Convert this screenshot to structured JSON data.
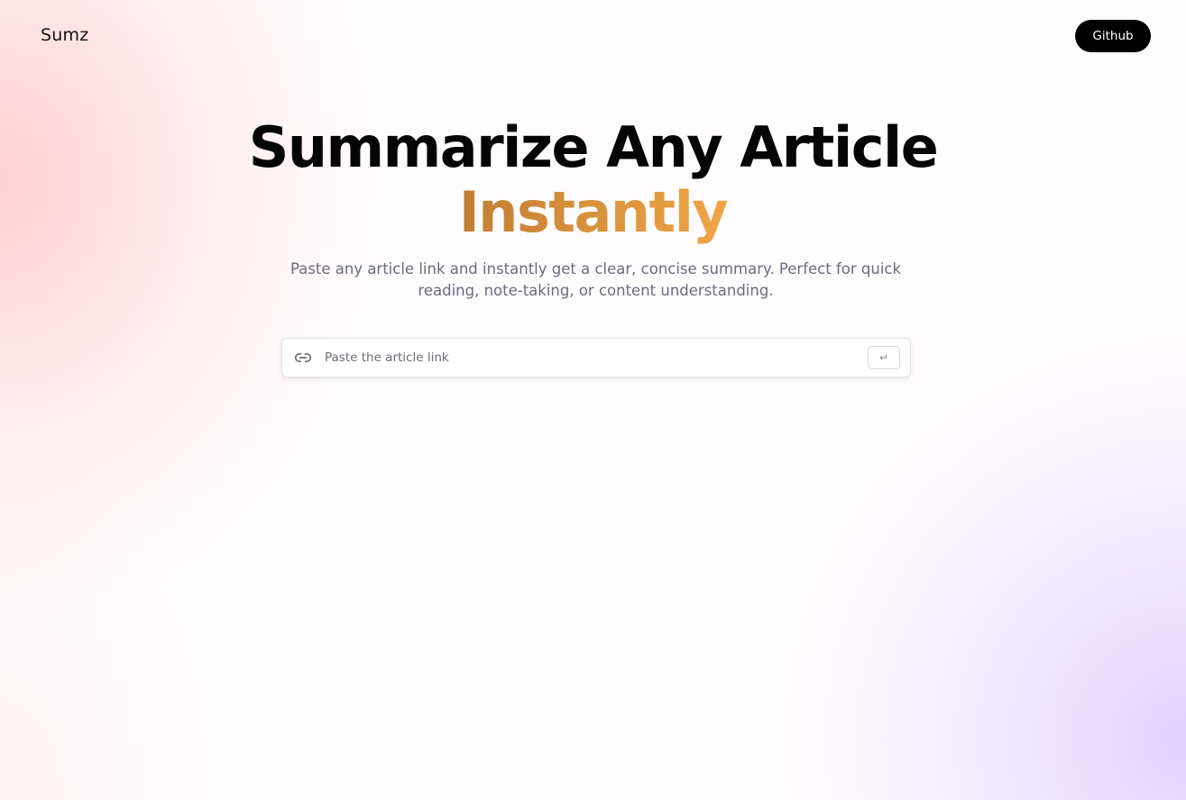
{
  "nav": {
    "logo": "Sumz",
    "github_label": "Github"
  },
  "hero": {
    "title": "Summarize Any Article",
    "title_accent": "Instantly",
    "subtitle_line1": "Paste any article link and instantly get a clear, concise summary. Perfect for quick",
    "subtitle_line2": "reading, note-taking, or content understanding."
  },
  "search": {
    "placeholder": "Paste the article link",
    "value": "",
    "submit_symbol": "↵",
    "icon": "link-icon"
  },
  "colors": {
    "accent_start": "#c07d34",
    "accent_end": "#f0a545",
    "button_bg": "#000000"
  }
}
